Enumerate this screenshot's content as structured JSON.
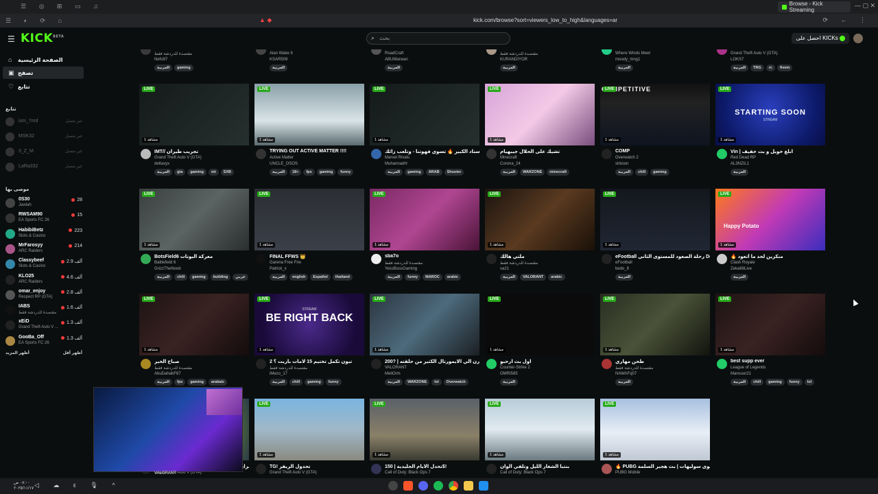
{
  "browser": {
    "tab_title": "Browse - Kick Streaming",
    "url": "kick.com/browse?sort=viewers_low_to_high&languages=ar"
  },
  "header": {
    "logo": "KICK",
    "logo_beta": "BETA",
    "search_placeholder": "بحث",
    "kicks_button": "احصل على KICKs"
  },
  "sidebar": {
    "nav": [
      {
        "label": "الصفحة الرئيسية",
        "icon": "home-icon"
      },
      {
        "label": "تصفح",
        "icon": "browse-icon"
      },
      {
        "label": "تتابع",
        "icon": "heart-icon"
      }
    ],
    "following_title": "تتابع",
    "following": [
      {
        "name": "ism_7md",
        "status": "غير متصل"
      },
      {
        "name": "MSK32",
        "status": "غير متصل"
      },
      {
        "name": "3_Z_M",
        "status": "غير متصل"
      },
      {
        "name": "LaRa332",
        "status": "غير متصل"
      }
    ],
    "recommended_title": "موصى بها",
    "recommended": [
      {
        "name": "0S30",
        "category": "Jawlah",
        "viewers": "28",
        "color": "#444"
      },
      {
        "name": "RWSAM90",
        "category": "EA Sports FC 26",
        "viewers": "15",
        "color": "#333"
      },
      {
        "name": "HabibiBetz",
        "category": "Slots & Casino",
        "viewers": "223",
        "color": "#2a8"
      },
      {
        "name": "MrFarosyy",
        "category": "ARC Raiders",
        "viewers": "214",
        "color": "#a58"
      },
      {
        "name": "Classybeef",
        "category": "Slots & Casino",
        "viewers": "2.9 ألف",
        "color": "#38a"
      },
      {
        "name": "KLO25",
        "category": "ARC Raiders",
        "viewers": "4.6 ألف",
        "color": "#222"
      },
      {
        "name": "omar_enjoy",
        "category": "Respect RP (GTA)",
        "viewers": "2.8 ألف",
        "color": "#555"
      },
      {
        "name": "IABS",
        "category": "مقتصدة للدردشة فقط",
        "viewers": "1.6 ألف",
        "color": "#111"
      },
      {
        "name": "xEiD",
        "category": "Grand Theft Auto V ...",
        "viewers": "1.3 ألف",
        "color": "#222"
      },
      {
        "name": "GooBa_Off",
        "category": "EA Sports FC 26",
        "viewers": "1.3 ألف",
        "color": "#a84"
      }
    ],
    "show_more": "أظهر المزيد",
    "show_less": "أظهر أقل"
  },
  "live_label": "LIVE",
  "viewers_label": "مشاهد 1",
  "cards_top": [
    {
      "category": "مقتصدة للدردشة فقط",
      "user": "Nefo97",
      "tags": [
        "العربية",
        "gaming"
      ],
      "color": "#3a3a3a"
    },
    {
      "category": "Alan Wake II",
      "user": "KSAR509",
      "tags": [
        "العربية"
      ],
      "color": "#444"
    },
    {
      "category": "RoadCraft",
      "user": "ABUMarwan",
      "tags": [
        "العربية"
      ],
      "color": "#555"
    },
    {
      "category": "مقتصدة للدردشة فقط",
      "user": "KURANDIYOR",
      "tags": [
        "العربية"
      ],
      "color": "#a98"
    },
    {
      "category": "Where Winds Meet",
      "user": "moody_mng1",
      "tags": [
        "العربية"
      ],
      "color": "#2c8"
    },
    {
      "category": "Grand Theft Auto V (GTA)",
      "user": "LOKS7",
      "tags": [
        "العربية",
        "TRG",
        "rc",
        "fivem"
      ],
      "color": "#a38"
    }
  ],
  "cards": [
    {
      "title": "IMT// تجريب طيران",
      "category": "Grand Theft Auto V (GTA)",
      "user": "deltaxyx",
      "tags": [
        "العربية",
        "gta",
        "gaming",
        "mt",
        "SXB"
      ],
      "bg": "bg-dark",
      "color": "#bbb"
    },
    {
      "title": "TRYING OUT ACTIVE MATTER !!!!",
      "category": "Active Matter",
      "user": "UNCLE_OSOS",
      "tags": [
        "العربية",
        "18+",
        "fps",
        "gaming",
        "funny"
      ],
      "bg": "bg-snow",
      "color": "#333"
    },
    {
      "title": "سناد الكبير 🔥 تسوي فهوتنا - وتلعب زائك",
      "category": "Marvel Rivals",
      "user": "MuhannadH",
      "tags": [
        "العربية",
        "gaming",
        "ARAB",
        "Shooter"
      ],
      "bg": "bg-dark",
      "color": "#36a"
    },
    {
      "title": "تشيك على الحلال جيبهيام",
      "category": "Minecraft",
      "user": "Corona_24",
      "tags": [
        "العربية",
        "WARZONE",
        "minecraft"
      ],
      "bg": "bg-pink",
      "color": "#333"
    },
    {
      "title": "COMP",
      "category": "Overwatch 2",
      "user": "slrkoon",
      "tags": [
        "العربية",
        "chill",
        "gaming"
      ],
      "bg": "bg-comp",
      "color": "#222",
      "overlay": "COMPETITIVE"
    },
    {
      "title": "Vin | ابلغ خويل و بث خفيف",
      "category": "Red Dead RP",
      "user": "AL3NZIL1",
      "tags": [
        "العربية"
      ],
      "bg": "bg-start",
      "color": "#2c6",
      "overlay": "STARTING SOON",
      "overlay_sub": "STREAM"
    },
    {
      "title": "BotsField6 معركة البوتات",
      "category": "Battlefield 6",
      "user": "GrizzTheNoob",
      "tags": [
        "العربية",
        "chill",
        "gaming",
        "building",
        "عربي"
      ],
      "bg": "bg-bf",
      "color": "#3a5"
    },
    {
      "title": "FINAL FFWS 👑",
      "category": "Garena Free Fire",
      "user": "Patrick_x",
      "tags": [
        "العربية",
        "english",
        "Español",
        "thailand"
      ],
      "bg": "bg-obs",
      "color": "#111"
    },
    {
      "title": "sba7o",
      "category": "مقتصدة للدردشة فقط",
      "user": "YessBossGaming",
      "tags": [
        "العربية",
        "funny",
        "MAROC",
        "arabic"
      ],
      "bg": "bg-room",
      "color": "#eee"
    },
    {
      "title": "ملتي هالك",
      "category": "مقتصدة للدردشة فقط",
      "user": "va21",
      "tags": [
        "العربية",
        "VALORANT",
        "arabic"
      ],
      "bg": "bg-pope",
      "color": "#222"
    },
    {
      "title": "eFootball رحلة الصعود للمستوى الثاني Devg...",
      "category": "eFootball",
      "user": "bedo_8",
      "tags": [
        "العربية"
      ],
      "bg": "bg-fb",
      "color": "#222"
    },
    {
      "title": "🔥 منكرين لحد ما أتعود",
      "category": "Clash Royale",
      "user": "Zeka69Live",
      "tags": [
        "العربية"
      ],
      "bg": "bg-potato",
      "color": "#ccc",
      "overlay": "Happy Potato"
    },
    {
      "title": "صباح الخير",
      "category": "مقتصدة للدردشة فقط",
      "user": "AbuDahabF87",
      "tags": [
        "العربية",
        "fps",
        "gaming",
        "arabaic"
      ],
      "bg": "bg-hs",
      "color": "#a82"
    },
    {
      "title": "تبون تكمل تختيم 15 لامات باربت ؟ 2",
      "category": "مقتصدة للدردشة فقط",
      "user": "iMezo_17",
      "tags": [
        "العربية",
        "chill",
        "gaming",
        "funny"
      ],
      "bg": "bg-brb",
      "color": "#222",
      "overlay": "BE RIGHT BACK",
      "overlay_sub": "STREAM"
    },
    {
      "title": "200? | هالة الاوورن الي الايمورتال الكثير من حلقته",
      "category": "VALORANT",
      "user": "MeliOrm",
      "tags": [
        "العربية",
        "WARZONE",
        "lol",
        "Overwatch"
      ],
      "bg": "bg-val",
      "color": "#222"
    },
    {
      "title": "اول بث ارحبو",
      "category": "Counter-Strike 2",
      "user": "OMRI585",
      "tags": [
        "العربية"
      ],
      "bg": "bg-black",
      "color": "#2c6"
    },
    {
      "title": "طحن مهاري",
      "category": "مقتصدة للدردشة فقط",
      "user": "NAWAFq07",
      "tags": [
        "العربية"
      ],
      "bg": "bg-cave",
      "color": "#a33"
    },
    {
      "title": "best supp ever",
      "category": "League of Legends",
      "user": "Mansuor21",
      "tags": [
        "العربية",
        "chill",
        "gaming",
        "funny",
        "lol"
      ],
      "bg": "bg-hs",
      "color": "#2c6"
    },
    {
      "title": "gta 5 | مقتطعة برايفر لقرات الحياة الواقعية | جديد",
      "category": "Grand Theft Auto V (GTA)",
      "user": "",
      "tags": [],
      "bg": "bg-map",
      "color": "#222"
    },
    {
      "title": "TG! تحدول الريفر",
      "category": "Grand Theft Auto V (GTA)",
      "user": "",
      "tags": [],
      "bg": "bg-tg",
      "color": "#222"
    },
    {
      "title": "تحدل الايام الجليدية | 150$!",
      "category": "Call of Duty: Black Ops 7",
      "user": "",
      "tags": [],
      "bg": "bg-cod",
      "color": "#335"
    },
    {
      "title": "بنتبا الشغار الليل وتلفي الوان",
      "category": "Call of Duty: Black Ops 7",
      "user": "",
      "tags": [],
      "bg": "bg-cod2",
      "color": "#222"
    },
    {
      "title": "🔥 PUBG آقوى سوليهات | بث هجير السلمة",
      "category": "PUBG Mobile",
      "user": "",
      "tags": [],
      "bg": "bg-pubg",
      "color": "#a55"
    }
  ],
  "pip_caption": "VALORANT",
  "taskbar": {
    "time": "٠٨:٠٠ ص",
    "date": "٢٠٢٥/١١/١٧"
  }
}
